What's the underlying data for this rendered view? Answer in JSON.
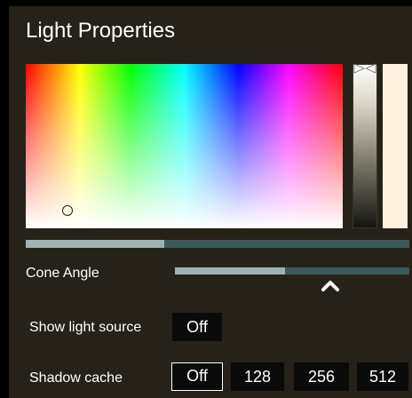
{
  "panel": {
    "title": "Light Properties"
  },
  "color_picker": {
    "selected_color": "#fdf3df",
    "hue_slider_fraction": 0.36
  },
  "cone_angle": {
    "label": "Cone Angle",
    "value_fraction": 0.47
  },
  "show_light_source": {
    "label": "Show light source",
    "value": "Off"
  },
  "shadow_cache": {
    "label": "Shadow cache",
    "options": [
      "Off",
      "128",
      "256",
      "512"
    ],
    "selected": "Off"
  },
  "colors": {
    "panel_bg": "#262219",
    "track": "#3b5a5b",
    "track_fill": "#9fb2b2",
    "button_bg": "#0a0a0a"
  }
}
